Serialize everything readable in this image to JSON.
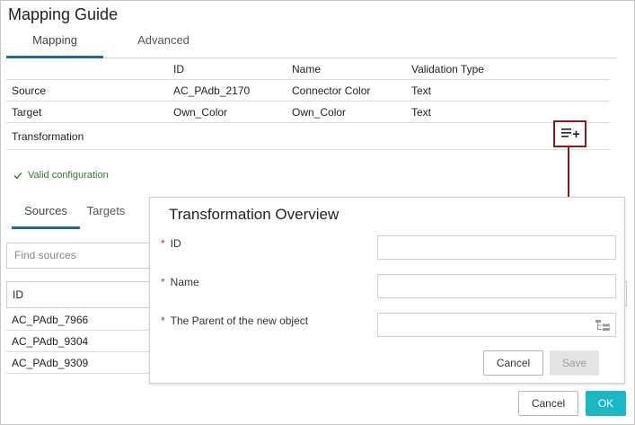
{
  "dialog": {
    "title": "Mapping Guide",
    "tabs": [
      {
        "label": "Mapping",
        "active": true
      },
      {
        "label": "Advanced",
        "active": false
      }
    ]
  },
  "mapping_table": {
    "columns": [
      "ID",
      "Name",
      "Validation Type"
    ],
    "rows": [
      {
        "label": "Source",
        "id": "AC_PAdb_2170",
        "name": "Connector Color",
        "type": "Text"
      },
      {
        "label": "Target",
        "id": "Own_Color",
        "name": "Own_Color",
        "type": "Text"
      },
      {
        "label": "Transformation",
        "id": "",
        "name": "",
        "type": ""
      }
    ]
  },
  "status": {
    "text": "Valid configuration",
    "color": "#2e7d32"
  },
  "lower_tabs": [
    {
      "label": "Sources",
      "active": true
    },
    {
      "label": "Targets",
      "active": false
    }
  ],
  "sources_panel": {
    "search_placeholder": "Find sources",
    "column": "ID",
    "items": [
      "AC_PAdb_7966",
      "AC_PAdb_9304",
      "AC_PAdb_9309"
    ]
  },
  "transformation_overview": {
    "title": "Transformation Overview",
    "fields": [
      {
        "label": "ID",
        "required": true,
        "value": ""
      },
      {
        "label": "Name",
        "required": true,
        "value": ""
      },
      {
        "label": "The Parent of the new object",
        "required": true,
        "value": ""
      }
    ],
    "required_marker": "*",
    "cancel_label": "Cancel",
    "save_label": "Save"
  },
  "footer": {
    "cancel_label": "Cancel",
    "ok_label": "OK"
  },
  "colors": {
    "accent": "#1f6c93",
    "ok_button": "#1ab8c4",
    "highlight": "#8b1a1f"
  },
  "icons": {
    "add_transformation": "list-add-icon",
    "check": "check-icon",
    "tree": "tree-icon"
  }
}
